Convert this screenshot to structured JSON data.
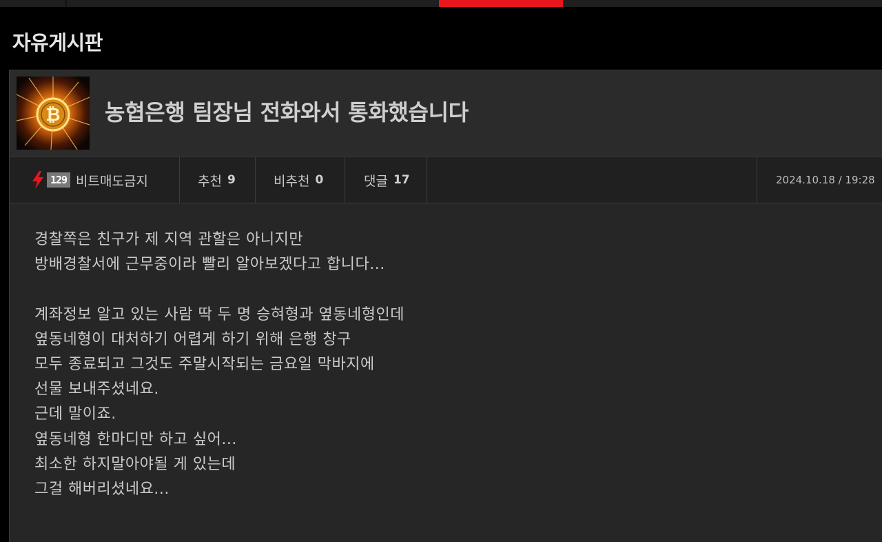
{
  "colors": {
    "accent": "#e8171d",
    "background": "#000000",
    "panel": "#262626",
    "text": "#c9c9c9"
  },
  "board": {
    "title": "자유게시판"
  },
  "post": {
    "thumbnail_icon": "bitcoin-coin-icon",
    "title": "농협은행 팀장님 전화와서 통화했습니다",
    "author": {
      "level_icon": "lightning-bolt-icon",
      "level_badge": "129",
      "name": "비트매도금지"
    },
    "recommend_label": "추천",
    "recommend_count": "9",
    "not_recommend_label": "비추천",
    "not_recommend_count": "0",
    "comment_label": "댓글",
    "comment_count": "17",
    "date": "2024.10.18 / 19:28",
    "body_lines": [
      "경찰쪽은 친구가 제 지역 관할은 아니지만",
      "방배경찰서에 근무중이라 빨리 알아보겠다고 합니다...",
      "",
      "계좌정보 알고 있는 사람 딱 두 명 승혀형과 옆동네형인데",
      "옆동네형이 대처하기 어렵게 하기 위해 은행 창구",
      "모두 종료되고 그것도 주말시작되는 금요일 막바지에",
      "선물 보내주셨네요.",
      "근데 말이죠.",
      "옆동네형 한마디만 하고 싶어...",
      "최소한 하지말아야될 게 있는데",
      "그걸 해버리셨네요..."
    ]
  }
}
